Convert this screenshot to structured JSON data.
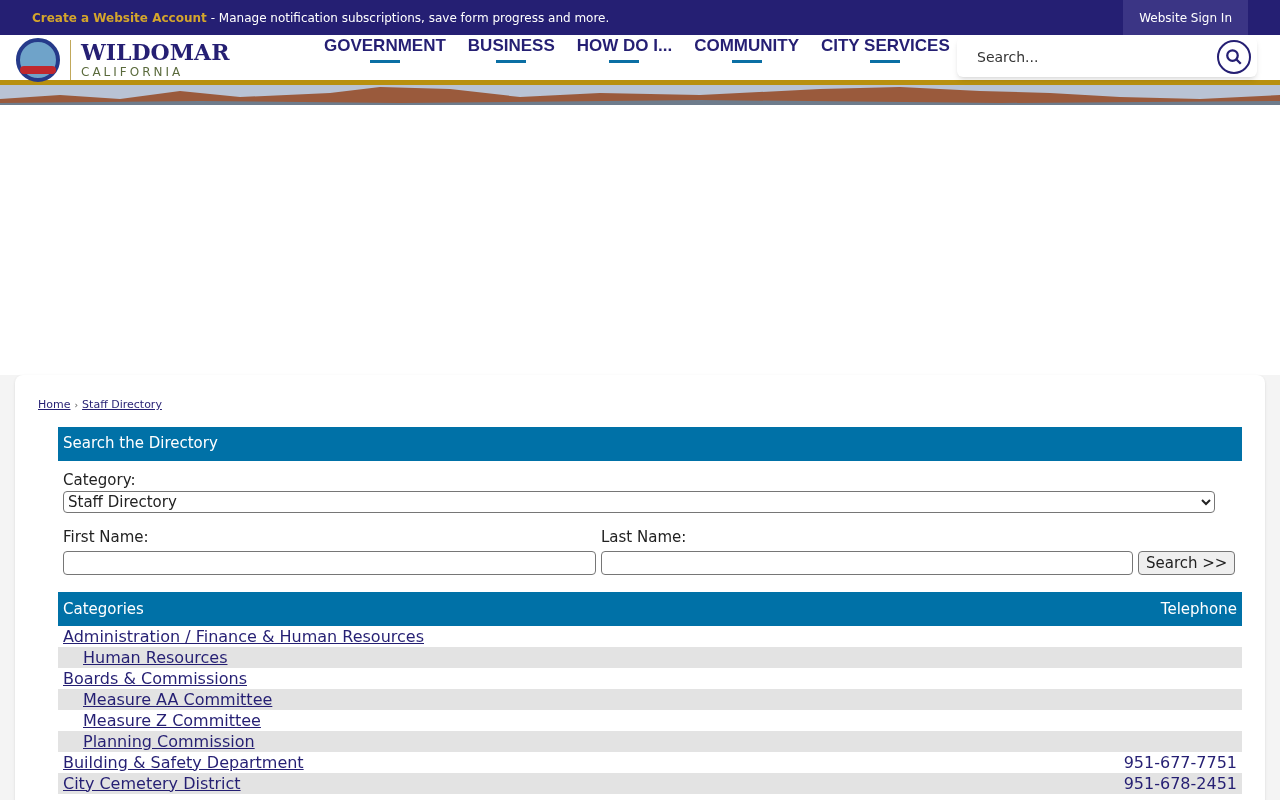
{
  "top_bar": {
    "account_link": "Create a Website Account",
    "message": "- Manage notification subscriptions, save form progress and more.",
    "sign_in": "Website Sign In"
  },
  "logo": {
    "name": "WILDOMAR",
    "state": "CALIFORNIA"
  },
  "nav": [
    "GOVERNMENT",
    "BUSINESS",
    "HOW DO I...",
    "COMMUNITY",
    "CITY SERVICES"
  ],
  "search": {
    "placeholder": "Search..."
  },
  "breadcrumb": [
    "Home",
    "Staff Directory"
  ],
  "breadcrumb_separator": "›",
  "directory_search": {
    "title": "Search the Directory",
    "category_label": "Category:",
    "category_value": "Staff Directory",
    "first_name_label": "First Name:",
    "last_name_label": "Last Name:",
    "button": "Search >>"
  },
  "table": {
    "columns": [
      "Categories",
      "Telephone"
    ],
    "rows": [
      {
        "name": "Administration / Finance & Human Resources",
        "children": [
          {
            "name": "Human Resources"
          }
        ]
      },
      {
        "name": "Boards & Commissions",
        "children": [
          {
            "name": "Measure AA Committee"
          },
          {
            "name": "Measure Z Committee"
          },
          {
            "name": "Planning Commission"
          }
        ]
      },
      {
        "name": "Building & Safety Department",
        "phone": "951-677-7751"
      },
      {
        "name": "City Cemetery District",
        "phone": "951-678-2451"
      }
    ]
  }
}
